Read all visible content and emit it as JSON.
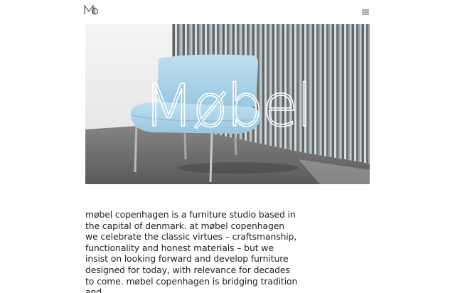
{
  "header": {
    "logo_icon": "mobel-monogram-icon",
    "menu_icon": "hamburger-menu-icon"
  },
  "hero": {
    "title": "Møbel",
    "image_description_icon": "light-blue-lounge-chair-photo"
  },
  "main": {
    "intro_text": "møbel copenhagen is a furniture studio based in the capital of denmark. at møbel copenhagen we celebrate the classic virtues – craftsmanship, functionality and honest materials – but we insist on looking forward and develop furniture designed for today, with relevance for decades to come. møbel copenhagen is bridging tradition and"
  },
  "colors": {
    "chair": "#a9d3ea",
    "floor": "#6d6d6d",
    "curtain": "#8f9598",
    "wall": "#f1f1f1"
  }
}
